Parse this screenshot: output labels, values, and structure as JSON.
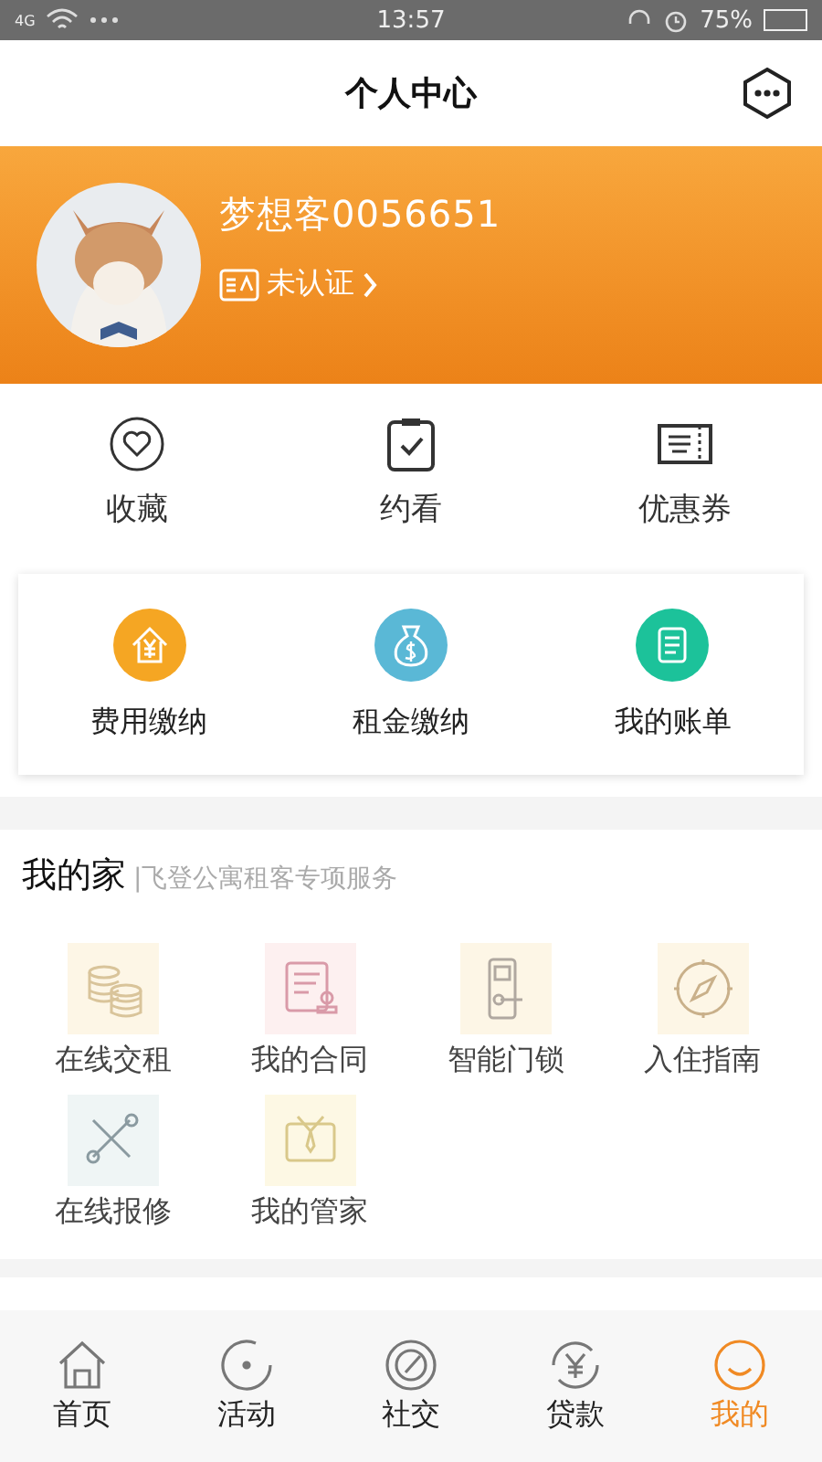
{
  "status_bar": {
    "network": "4G",
    "time": "13:57",
    "battery": "75%"
  },
  "header": {
    "title": "个人中心"
  },
  "profile": {
    "name": "梦想客0056651",
    "verification": "未认证"
  },
  "quick_links": [
    {
      "kind": "heart",
      "label": "收藏"
    },
    {
      "kind": "clipboard",
      "label": "约看"
    },
    {
      "kind": "coupon",
      "label": "优惠券"
    }
  ],
  "payments": [
    {
      "kind": "house",
      "label": "费用缴纳",
      "color": "#f5a623"
    },
    {
      "kind": "moneybag",
      "label": "租金缴纳",
      "color": "#5ab8d6"
    },
    {
      "kind": "bill",
      "label": "我的账单",
      "color": "#1cc29a"
    }
  ],
  "my_home": {
    "title": "我的家",
    "subtitle": "|飞登公寓租客专项服务",
    "items": [
      {
        "kind": "coins",
        "label": "在线交租",
        "color": "#fdf6e6"
      },
      {
        "kind": "contract",
        "label": "我的合同",
        "color": "#fdf0f0"
      },
      {
        "kind": "lock",
        "label": "智能门锁",
        "color": "#fdf6e6"
      },
      {
        "kind": "compass",
        "label": "入住指南",
        "color": "#fdf6e6"
      },
      {
        "kind": "tools",
        "label": "在线报修",
        "color": "#eff5f5"
      },
      {
        "kind": "steward",
        "label": "我的管家",
        "color": "#fdf8e4"
      }
    ]
  },
  "tab_bar": [
    {
      "kind": "home",
      "label": "首页",
      "selected": false
    },
    {
      "kind": "activity",
      "label": "活动",
      "selected": false
    },
    {
      "kind": "social",
      "label": "社交",
      "selected": false
    },
    {
      "kind": "loan",
      "label": "贷款",
      "selected": false
    },
    {
      "kind": "me",
      "label": "我的",
      "selected": true
    }
  ]
}
